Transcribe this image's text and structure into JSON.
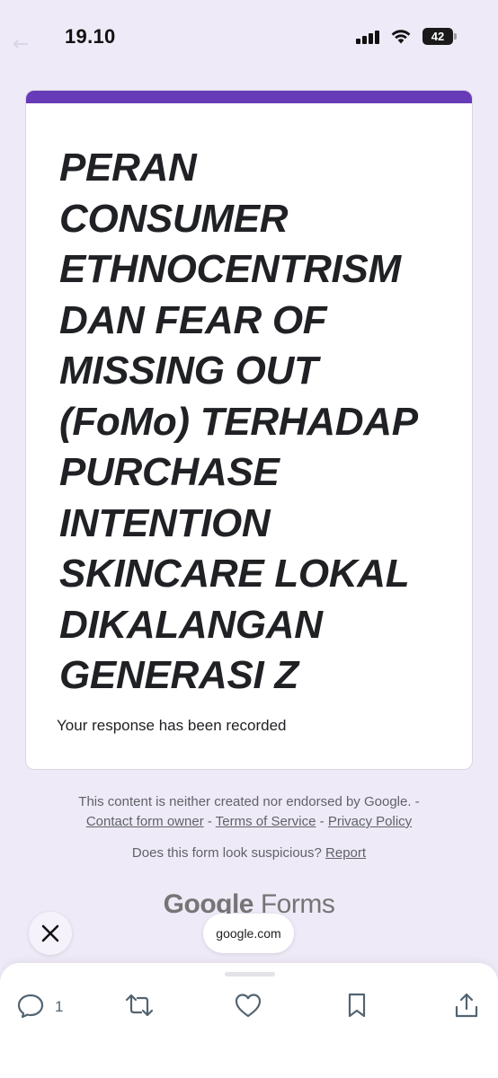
{
  "status_bar": {
    "time": "19.10",
    "battery": "42"
  },
  "form": {
    "title_lines": [
      "PERAN",
      "CONSUMER",
      "ETHNOCENTRISM",
      "DAN FEAR OF",
      "MISSING OUT",
      "(FoMo) TERHADAP",
      "PURCHASE",
      "INTENTION",
      "SKINCARE LOKAL",
      "DIKALANGAN",
      "GENERASI Z"
    ],
    "response_message": "Your response has been recorded",
    "accent_color": "#673ab7"
  },
  "footer": {
    "disclaimer": "This content is neither created nor endorsed by Google. -",
    "contact_link": "Contact form owner",
    "terms_link": "Terms of Service",
    "privacy_link": "Privacy Policy",
    "separator": "-",
    "suspicious_text": "Does this form look suspicious?",
    "report_link": "Report",
    "brand_google": "Google",
    "brand_forms": "Forms"
  },
  "browser": {
    "url": "google.com"
  },
  "actions": {
    "reply_count": "1",
    "icons": [
      "reply-icon",
      "retweet-icon",
      "like-icon",
      "bookmark-icon",
      "share-icon"
    ]
  }
}
